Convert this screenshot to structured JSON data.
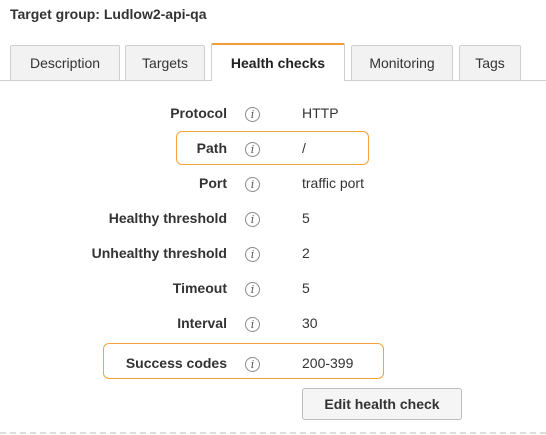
{
  "title": "Target group: Ludlow2-api-qa",
  "tabs": [
    {
      "label": "Description",
      "active": false
    },
    {
      "label": "Targets",
      "active": false
    },
    {
      "label": "Health checks",
      "active": true
    },
    {
      "label": "Monitoring",
      "active": false
    },
    {
      "label": "Tags",
      "active": false
    }
  ],
  "info_glyph": "i",
  "fields": [
    {
      "label": "Protocol",
      "value": "HTTP"
    },
    {
      "label": "Path",
      "value": "/"
    },
    {
      "label": "Port",
      "value": "traffic port"
    },
    {
      "label": "Healthy threshold",
      "value": "5"
    },
    {
      "label": "Unhealthy threshold",
      "value": "2"
    },
    {
      "label": "Timeout",
      "value": "5"
    },
    {
      "label": "Interval",
      "value": "30"
    },
    {
      "label": "Success codes",
      "value": "200-399"
    }
  ],
  "edit_button": "Edit health check",
  "colors": {
    "accent": "#f29c38",
    "highlight": "#f2a33a"
  }
}
